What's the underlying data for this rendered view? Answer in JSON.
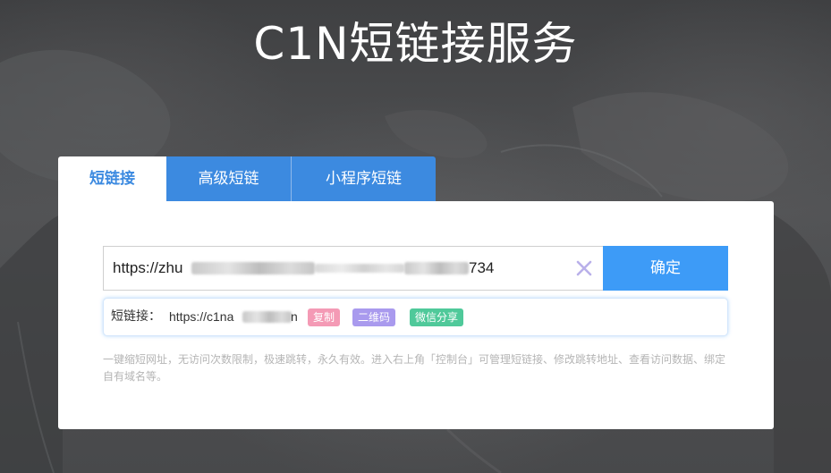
{
  "page": {
    "title": "C1N短链接服务"
  },
  "tabs": [
    {
      "label": "短链接",
      "active": true
    },
    {
      "label": "高级短链",
      "active": false
    },
    {
      "label": "小程序短链",
      "active": false
    }
  ],
  "form": {
    "url_value_start": "https://zhu",
    "url_value_end": "734",
    "confirm_label": "确定",
    "clear_icon": "close-icon"
  },
  "result": {
    "label": "短链接：",
    "url_start": "https://c1na",
    "url_end": "n",
    "copy_label": "复制",
    "qrcode_label": "二维码",
    "wechat_share_label": "微信分享"
  },
  "note": "一键缩短网址，无访问次数限制，极速跳转，永久有效。进入右上角「控制台」可管理短链接、修改跳转地址、查看访问数据、绑定自有域名等。",
  "colors": {
    "primary": "#3d9bf7",
    "tab_blue": "#3c8ae0",
    "copy_badge": "#f49ab5",
    "qrcode_badge": "#a99aee",
    "wechat_badge": "#4fc99a",
    "clear_icon": "#b9b0ea"
  }
}
